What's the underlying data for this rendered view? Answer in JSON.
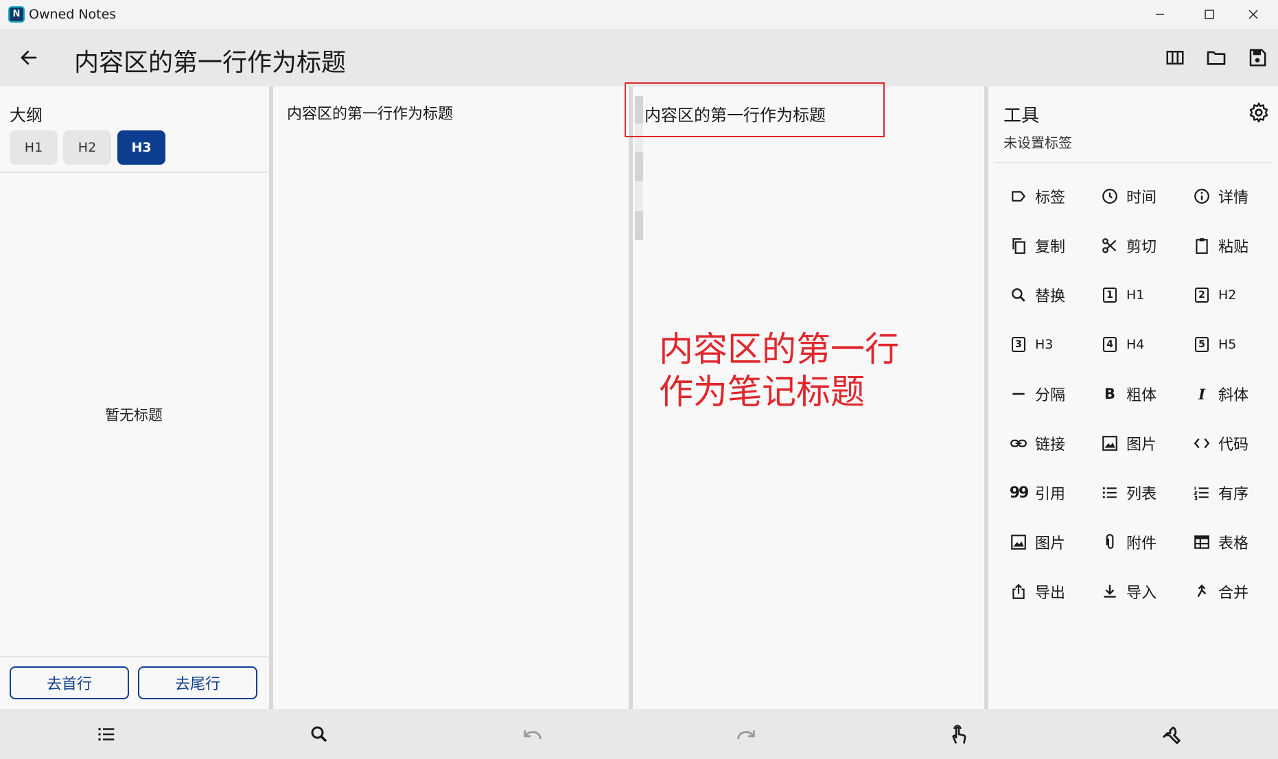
{
  "window": {
    "app_icon_letter": "N",
    "title": "Owned Notes",
    "icons": [
      "minimize-icon",
      "maximize-icon",
      "close-icon"
    ]
  },
  "header": {
    "note_title": "内容区的第一行作为标题",
    "icons": [
      "back-arrow-icon",
      "columns-icon",
      "folder-icon",
      "save-icon"
    ]
  },
  "outline": {
    "title": "大纲",
    "levels": [
      "H1",
      "H2",
      "H3"
    ],
    "active_level": "H3",
    "empty_text": "暂无标题",
    "go_first_label": "去首行",
    "go_last_label": "去尾行"
  },
  "editor": {
    "content_line": "内容区的第一行作为标题"
  },
  "preview": {
    "content_line": "内容区的第一行作为标题",
    "annotation_line1": "内容区的第一行",
    "annotation_line2": "作为笔记标题",
    "annotation_color": "#e0282e"
  },
  "tools": {
    "title": "工具",
    "subtitle": "未设置标签",
    "items": [
      {
        "label": "标签",
        "icon": "label-icon"
      },
      {
        "label": "时间",
        "icon": "clock-icon"
      },
      {
        "label": "详情",
        "icon": "info-icon"
      },
      {
        "label": "复制",
        "icon": "copy-icon"
      },
      {
        "label": "剪切",
        "icon": "scissors-icon"
      },
      {
        "label": "粘贴",
        "icon": "clipboard-icon"
      },
      {
        "label": "替换",
        "icon": "search-icon"
      },
      {
        "label": "H1",
        "icon": "h1-box-icon"
      },
      {
        "label": "H2",
        "icon": "h2-box-icon"
      },
      {
        "label": "H3",
        "icon": "h3-box-icon"
      },
      {
        "label": "H4",
        "icon": "h4-box-icon"
      },
      {
        "label": "H5",
        "icon": "h5-box-icon"
      },
      {
        "label": "分隔",
        "icon": "horizontal-rule-icon"
      },
      {
        "label": "粗体",
        "icon": "bold-icon"
      },
      {
        "label": "斜体",
        "icon": "italic-icon"
      },
      {
        "label": "链接",
        "icon": "link-icon"
      },
      {
        "label": "图片",
        "icon": "image-icon"
      },
      {
        "label": "代码",
        "icon": "code-icon"
      },
      {
        "label": "引用",
        "icon": "quote-icon"
      },
      {
        "label": "列表",
        "icon": "bullet-list-icon"
      },
      {
        "label": "有序",
        "icon": "numbered-list-icon"
      },
      {
        "label": "图片",
        "icon": "image-icon"
      },
      {
        "label": "附件",
        "icon": "paperclip-icon"
      },
      {
        "label": "表格",
        "icon": "table-icon"
      },
      {
        "label": "导出",
        "icon": "share-icon"
      },
      {
        "label": "导入",
        "icon": "download-icon"
      },
      {
        "label": "合并",
        "icon": "merge-icon"
      }
    ]
  },
  "bottom_bar": {
    "icons": [
      "outline-list-icon",
      "search-icon",
      "undo-icon",
      "redo-icon",
      "touch-icon",
      "wrench-icon"
    ]
  },
  "colors": {
    "accent": "#0d3d8f",
    "highlight": "#e0282e",
    "bar_background": "#e8e8e8"
  }
}
